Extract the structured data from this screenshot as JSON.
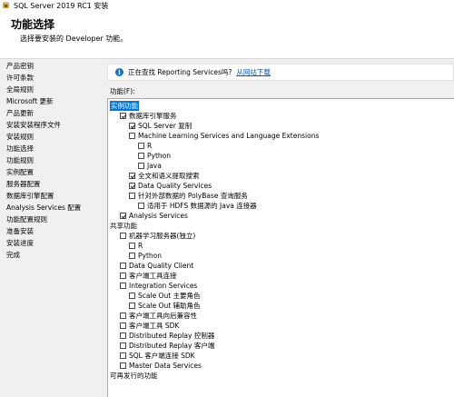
{
  "window": {
    "title": "SQL Server 2019 RC1 安装"
  },
  "header": {
    "title": "功能选择",
    "subtitle": "选择要安装的 Developer 功能。"
  },
  "nav": {
    "items": [
      "产品密钥",
      "许可条款",
      "全局规则",
      "Microsoft 更新",
      "产品更新",
      "安装安装程序文件",
      "安装规则",
      "功能选择",
      "功能规则",
      "实例配置",
      "服务器配置",
      "数据库引擎配置",
      "Analysis Services 配置",
      "功能配置规则",
      "准备安装",
      "安装进度",
      "完成"
    ]
  },
  "info": {
    "icon": "info-icon",
    "text": "正在查找 Reporting Services吗?",
    "link": "从网站下载"
  },
  "features": {
    "label": "功能(F):",
    "instance_group": "实例功能",
    "items": [
      {
        "label": "数据库引擎服务",
        "checked": true
      },
      {
        "label": "SQL Server 复制",
        "checked": true
      },
      {
        "label": "Machine Learning Services and Language Extensions",
        "checked": false
      },
      {
        "label": "R",
        "checked": false
      },
      {
        "label": "Python",
        "checked": false
      },
      {
        "label": "Java",
        "checked": false
      },
      {
        "label": "全文和语义提取搜索",
        "checked": true
      },
      {
        "label": "Data Quality Services",
        "checked": true
      },
      {
        "label": "针对外部数据的 PolyBase 查询服务",
        "checked": false
      },
      {
        "label": "适用于 HDFS 数据源的 Java 连接器",
        "checked": false
      },
      {
        "label": "Analysis Services",
        "checked": true
      }
    ],
    "shared_group": "共享功能",
    "shared_items": [
      {
        "label": "机器学习服务器(独立)",
        "checked": false
      },
      {
        "label": "R",
        "checked": false
      },
      {
        "label": "Python",
        "checked": false
      },
      {
        "label": "Data Quality Client",
        "checked": false
      },
      {
        "label": "客户端工具连接",
        "checked": false
      },
      {
        "label": "Integration Services",
        "checked": false
      },
      {
        "label": "Scale Out 主要角色",
        "checked": false
      },
      {
        "label": "Scale Out 辅助角色",
        "checked": false
      },
      {
        "label": "客户端工具向后兼容性",
        "checked": false
      },
      {
        "label": "客户端工具 SDK",
        "checked": false
      },
      {
        "label": "Distributed Replay 控制器",
        "checked": false
      },
      {
        "label": "Distributed Replay 客户端",
        "checked": false
      },
      {
        "label": "SQL 客户端连接 SDK",
        "checked": false
      },
      {
        "label": "Master Data Services",
        "checked": false
      }
    ],
    "redist_group": "可再发行的功能"
  },
  "colors": {
    "accent": "#0078d7",
    "link": "#0a55b8",
    "info": "#1f6fbf"
  }
}
